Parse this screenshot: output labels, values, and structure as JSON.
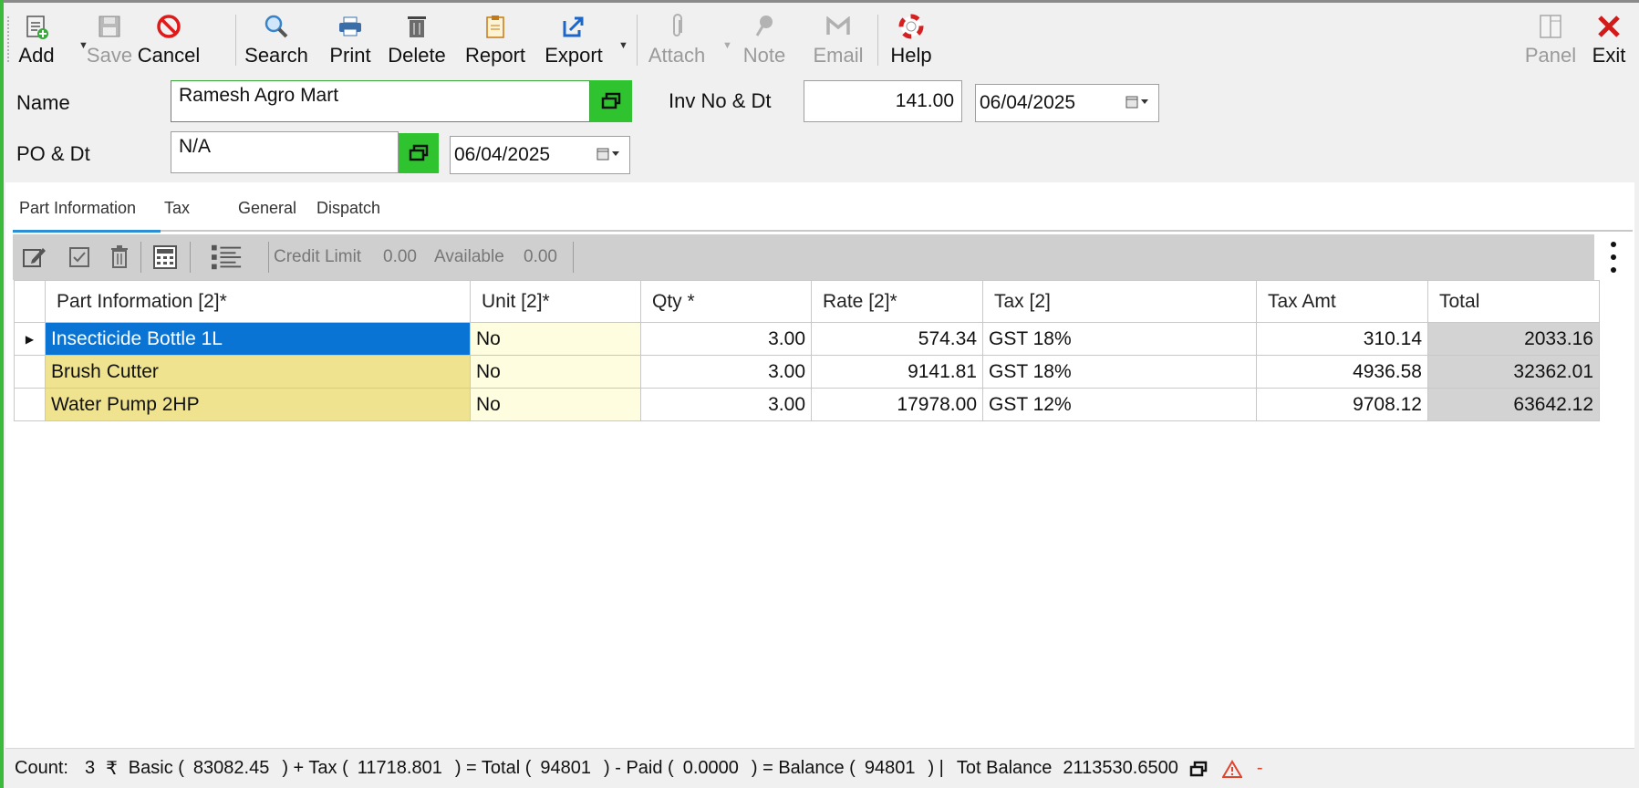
{
  "toolbar": {
    "add": "Add",
    "save": "Save",
    "cancel": "Cancel",
    "search": "Search",
    "print": "Print",
    "delete": "Delete",
    "report": "Report",
    "export": "Export",
    "attach": "Attach",
    "note": "Note",
    "email": "Email",
    "help": "Help",
    "panel": "Panel",
    "exit": "Exit"
  },
  "form": {
    "name_label": "Name",
    "name_value": "Ramesh Agro Mart",
    "inv_label": "Inv No & Dt",
    "inv_no": "141.00",
    "inv_date": "06/04/2025",
    "po_label": "PO & Dt",
    "po_value": "N/A",
    "po_date": "06/04/2025"
  },
  "tabs": [
    {
      "label": "Part Information",
      "active": true
    },
    {
      "label": "Tax",
      "active": false
    },
    {
      "label": "General",
      "active": false
    },
    {
      "label": "Dispatch",
      "active": false
    }
  ],
  "grid_toolbar": {
    "credit_limit_label": "Credit Limit",
    "credit_limit_value": "0.00",
    "available_label": "Available",
    "available_value": "0.00"
  },
  "grid": {
    "columns": [
      "Part Information [2]*",
      "Unit [2]*",
      "Qty *",
      "Rate [2]*",
      "Tax [2]",
      "Tax Amt",
      "Total"
    ],
    "rows": [
      {
        "part": "Insecticide Bottle 1L",
        "unit": "No",
        "qty": "3.00",
        "rate": "574.34",
        "tax": "GST 18%",
        "tax_amt": "310.14",
        "total": "2033.16"
      },
      {
        "part": "Brush Cutter",
        "unit": "No",
        "qty": "3.00",
        "rate": "9141.81",
        "tax": "GST 18%",
        "tax_amt": "4936.58",
        "total": "32362.01"
      },
      {
        "part": "Water Pump 2HP",
        "unit": "No",
        "qty": "3.00",
        "rate": "17978.00",
        "tax": "GST 12%",
        "tax_amt": "9708.12",
        "total": "63642.12"
      }
    ]
  },
  "status": {
    "count_label": "Count:",
    "count": "3",
    "currency": "₹",
    "basic_label": "Basic (",
    "basic": "83082.45",
    "tax_label": ") + Tax (",
    "tax": "11718.801",
    "total_label": ") = Total (",
    "total": "94801",
    "paid_label": ") - Paid (",
    "paid": "0.0000",
    "balance_label": ") = Balance (",
    "balance": "94801",
    "close_sep": ")  |",
    "tot_balance_label": "Tot Balance",
    "tot_balance": "2113530.6500",
    "dash": "-"
  },
  "colors": {
    "accent_green": "#2fc42f",
    "selected_cell": "#0a74d4",
    "part_cell": "#efe38f",
    "unit_cell": "#fffde0",
    "total_cell": "#d3d3d3",
    "tab_underline": "#2b8fd6"
  }
}
